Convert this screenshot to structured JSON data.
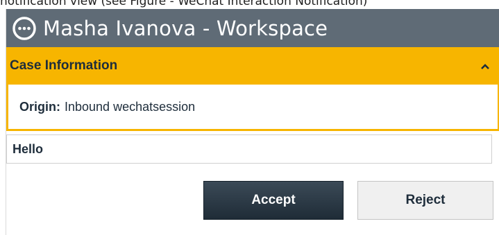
{
  "caption": "notification view (see Figure - WeChat Interaction Notification)",
  "window": {
    "title": "Masha Ivanova - Workspace",
    "icon": "chat-bubble-icon"
  },
  "case_info": {
    "header": "Case Information",
    "collapse_icon": "chevron-up-icon",
    "origin_label": "Origin:",
    "origin_value": "Inbound wechatsession"
  },
  "message": {
    "text": "Hello"
  },
  "actions": {
    "accept_label": "Accept",
    "reject_label": "Reject"
  },
  "colors": {
    "titlebar": "#5f6b76",
    "accent": "#f7b500",
    "accept_button": "#2b3945",
    "text": "#1e2d3b"
  }
}
